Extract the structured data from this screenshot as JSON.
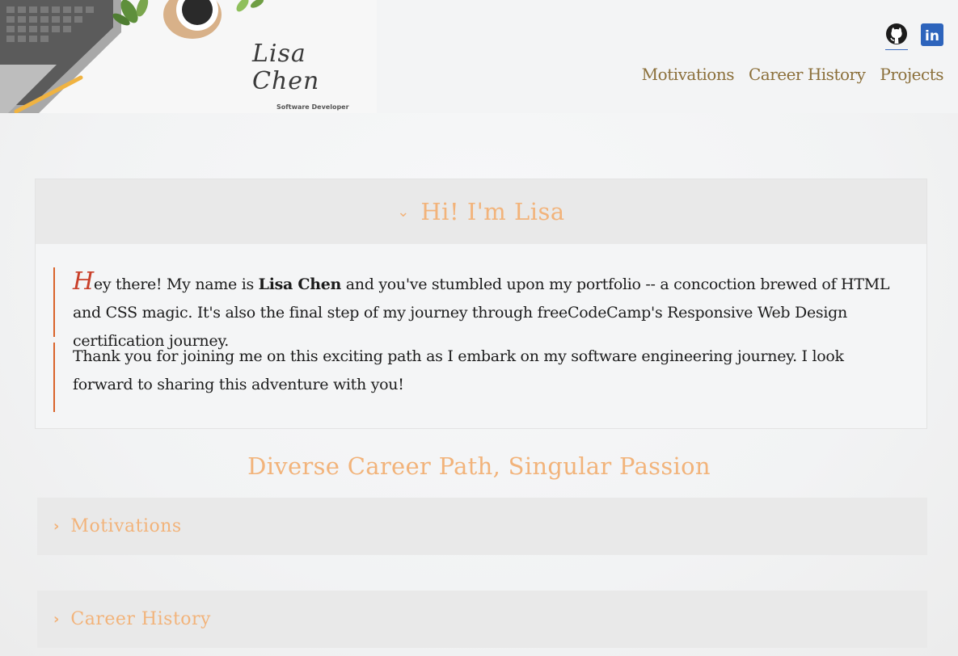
{
  "header": {
    "signature": "Lisa Chen",
    "role": "Software Developer",
    "social": [
      {
        "icon": "github-icon"
      },
      {
        "icon": "linkedin-icon",
        "text": "in"
      }
    ],
    "nav": [
      "Motivations",
      "Career History",
      "Projects"
    ]
  },
  "intro": {
    "title": "Hi! I'm Lisa",
    "p1": {
      "dropcap": "H",
      "before": "ey there! My name is ",
      "name": "Lisa Chen",
      "after": " and you've stumbled upon my portfolio -- a concoction brewed of HTML and CSS magic. It's also the final step of my journey through freeCodeCamp's Responsive Web Design certification journey."
    },
    "p2": "Thank you for joining me on this exciting path as I embark on my software engineering journey. I look forward to sharing this adventure with you!"
  },
  "section": {
    "title": "Diverse Career Path, Singular Passion",
    "accordions": [
      {
        "label": "Motivations"
      },
      {
        "label": "Career History"
      }
    ]
  },
  "colors": {
    "accent": "#f2b37a",
    "nav": "#8b6f3a",
    "quote_border": "#d9632a",
    "linkedin": "#2d64bc"
  }
}
